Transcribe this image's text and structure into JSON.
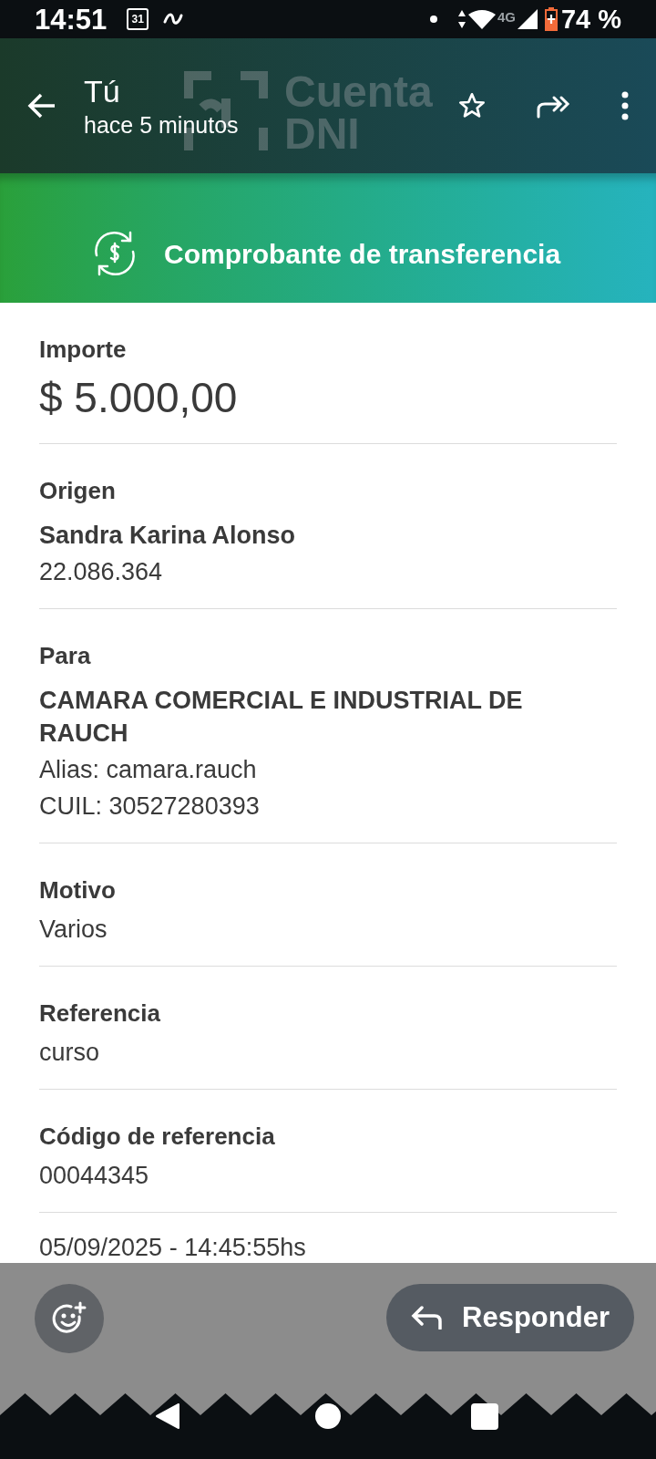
{
  "status_bar": {
    "time": "14:51",
    "calendar_day": "31",
    "battery": "74 %",
    "network": "4G"
  },
  "header": {
    "title": "Tú",
    "subtitle": "hace 5 minutos",
    "logo_lines": [
      "Cuenta",
      "DNI"
    ]
  },
  "banner": {
    "title": "Comprobante de transferencia"
  },
  "fields": [
    {
      "label": "Importe",
      "lines": [
        {
          "kind": "amount",
          "text": "$ 5.000,00"
        }
      ]
    },
    {
      "label": "Origen",
      "lines": [
        {
          "kind": "name",
          "text": "Sandra Karina Alonso"
        },
        {
          "kind": "plain",
          "text": "22.086.364"
        }
      ]
    },
    {
      "label": "Para",
      "lines": [
        {
          "kind": "name",
          "text": "CAMARA COMERCIAL E INDUSTRIAL DE RAUCH"
        },
        {
          "kind": "plain",
          "text": "Alias: camara.rauch"
        },
        {
          "kind": "plain",
          "text": "CUIL: 30527280393"
        }
      ]
    },
    {
      "label": "Motivo",
      "lines": [
        {
          "kind": "plain",
          "text": "Varios"
        }
      ]
    },
    {
      "label": "Referencia",
      "lines": [
        {
          "kind": "plain",
          "text": "curso"
        }
      ]
    },
    {
      "label": "Código de referencia",
      "lines": [
        {
          "kind": "plain",
          "text": "00044345"
        }
      ]
    }
  ],
  "timestamp": "05/09/2025 - 14:45:55hs",
  "reply_button": "Responder"
}
